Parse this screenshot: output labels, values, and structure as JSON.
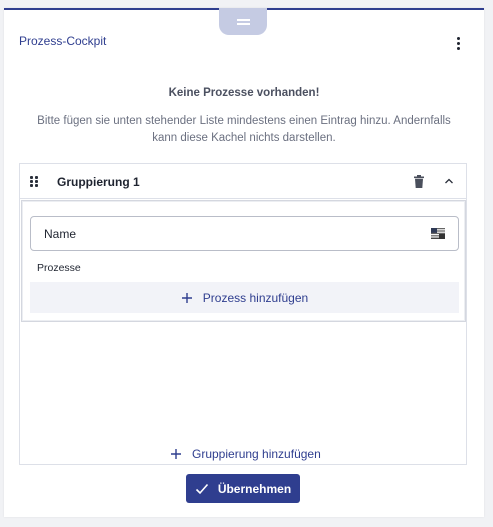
{
  "tile": {
    "title": "Prozess-Cockpit",
    "menu_icon": "kebab-menu-icon",
    "drag_icon": "drag-handle-icon"
  },
  "empty_state": {
    "heading": "Keine Prozesse vorhanden!",
    "text": "Bitte fügen sie unten stehender Liste mindestens einen Eintrag hinzu. Andernfalls kann diese Kachel nichts darstellen."
  },
  "group": {
    "title": "Gruppierung 1",
    "delete_icon": "trash-icon",
    "collapse_icon": "chevron-up-icon",
    "name_field": {
      "placeholder": "Name",
      "value": ""
    },
    "translation_icon": "language-flag-icon",
    "processes_label": "Prozesse",
    "add_process_label": "Prozess hinzufügen"
  },
  "add_group_label": "Gruppierung hinzufügen",
  "apply_label": "Übernehmen",
  "colors": {
    "accent": "#2f3e8f",
    "handle": "#c5cbe3",
    "add_row_bg": "#f2f3f8",
    "background": "#f1f2f5"
  }
}
